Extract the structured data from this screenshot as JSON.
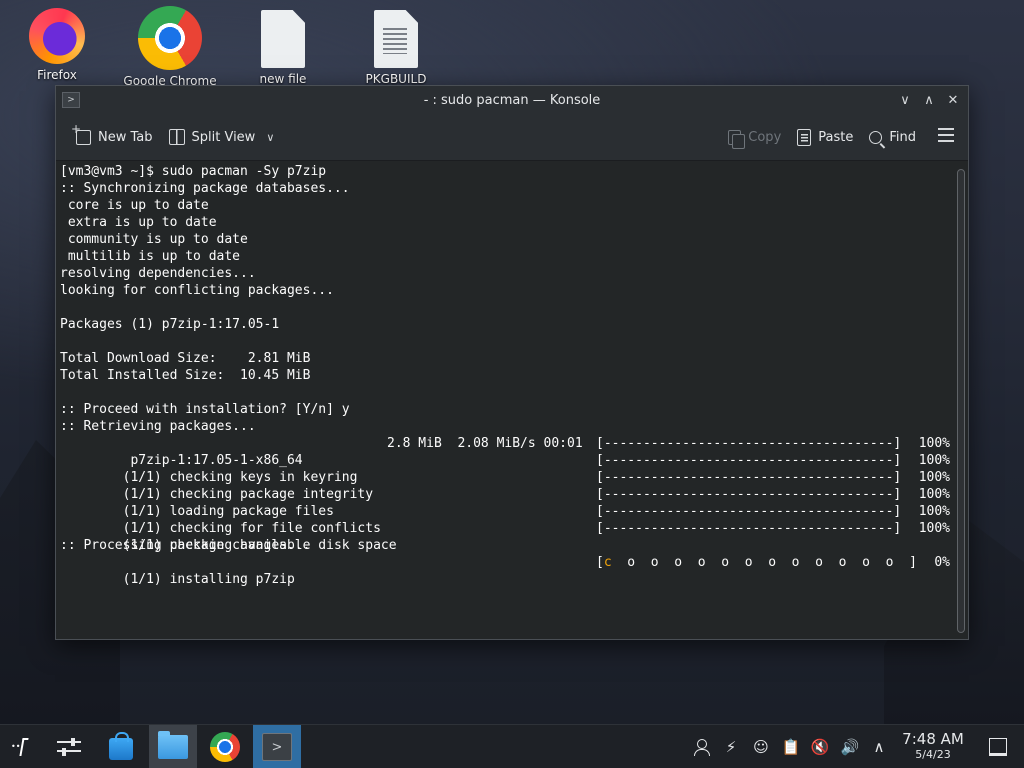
{
  "desktop": {
    "icons": [
      {
        "label": "Firefox"
      },
      {
        "label": "Google Chrome"
      },
      {
        "label": "new file"
      },
      {
        "label": "PKGBUILD"
      }
    ]
  },
  "window": {
    "app_icon": ">",
    "title": "- : sudo pacman — Konsole",
    "controls": {
      "minimize": "∨",
      "maximize": "∧",
      "close": "✕"
    }
  },
  "toolbar": {
    "new_tab": "New Tab",
    "split_view": "Split View",
    "copy": "Copy",
    "paste": "Paste",
    "find": "Find"
  },
  "terminal": {
    "lines": [
      "[vm3@vm3 ~]$ sudo pacman -Sy p7zip",
      ":: Synchronizing package databases...",
      " core is up to date",
      " extra is up to date",
      " community is up to date",
      " multilib is up to date",
      "resolving dependencies...",
      "looking for conflicting packages...",
      "",
      "Packages (1) p7zip-1:17.05-1",
      "",
      "Total Download Size:    2.81 MiB",
      "Total Installed Size:  10.45 MiB",
      "",
      ":: Proceed with installation? [Y/n] y",
      ":: Retrieving packages..."
    ],
    "download_row": {
      "name": " p7zip-1:17.05-1-x86_64",
      "meta": "2.8 MiB  2.08 MiB/s 00:01",
      "bar": "[-------------------------------------]",
      "pct": "100%"
    },
    "progress_rows": [
      {
        "text": "(1/1) checking keys in keyring",
        "bar": "[-------------------------------------]",
        "pct": "100%"
      },
      {
        "text": "(1/1) checking package integrity",
        "bar": "[-------------------------------------]",
        "pct": "100%"
      },
      {
        "text": "(1/1) loading package files",
        "bar": "[-------------------------------------]",
        "pct": "100%"
      },
      {
        "text": "(1/1) checking for file conflicts",
        "bar": "[-------------------------------------]",
        "pct": "100%"
      },
      {
        "text": "(1/1) checking available disk space",
        "bar": "[-------------------------------------]",
        "pct": "100%"
      }
    ],
    "processing_line": ":: Processing package changes...",
    "install_row": {
      "text": "(1/1) installing p7zip",
      "bar_open": "[",
      "pacman": "c",
      "dots": "  o  o  o  o  o  o  o  o  o  o  o  o  ]",
      "pct": "0%"
    }
  },
  "taskbar": {
    "time": "7:48 AM",
    "date": "5/4/23",
    "tray_icons": [
      "user-icon",
      "update-icon",
      "accessibility-icon",
      "clipboard-icon",
      "mute-icon",
      "volume-icon",
      "expand-icon"
    ]
  }
}
